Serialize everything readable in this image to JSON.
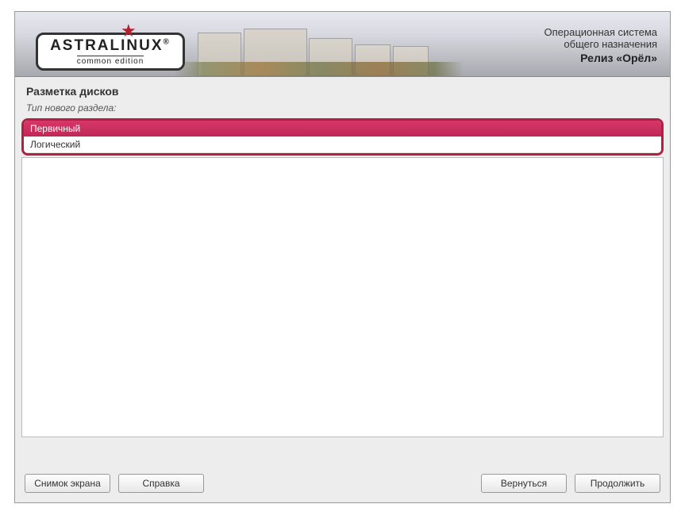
{
  "logo": {
    "brand": "ASTRALINUX",
    "edition": "common edition",
    "reg": "®"
  },
  "header": {
    "line1": "Операционная система",
    "line2": "общего назначения",
    "line3": "Релиз «Орёл»"
  },
  "page": {
    "title": "Разметка дисков",
    "subtitle": "Тип нового раздела:"
  },
  "options": {
    "primary": "Первичный",
    "logical": "Логический"
  },
  "buttons": {
    "screenshot": "Снимок экрана",
    "help": "Справка",
    "back": "Вернуться",
    "continue": "Продолжить"
  }
}
